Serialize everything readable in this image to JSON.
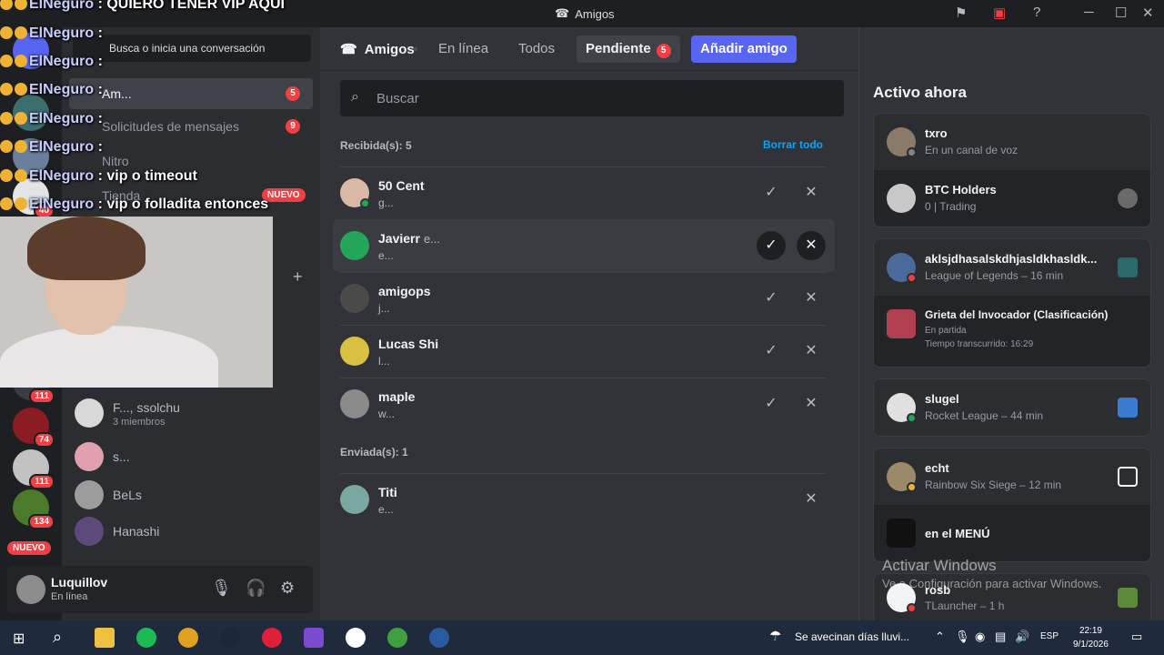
{
  "window": {
    "title": "Amigos",
    "min": "─",
    "max": "☐",
    "close": "✕"
  },
  "sidebar": {
    "search_label": "Busca o inicia una conversación",
    "items": [
      {
        "label": "Am...",
        "count": "5"
      },
      {
        "label": "Solicitudes de mensajes",
        "count": "9"
      },
      {
        "label": "Nitro"
      },
      {
        "label": "Tienda",
        "badge": "NUEVO"
      }
    ],
    "guild_badges": [
      "111",
      "74",
      "111",
      "134"
    ],
    "guild_top_badge": "40",
    "nuevo_badge": "NUEVO",
    "dms": [
      {
        "name": "F..., ssolchu",
        "sub": "3 miembros"
      },
      {
        "name": "s...",
        "sub": ""
      },
      {
        "name": "BeLs",
        "sub": ""
      },
      {
        "name": "Hanashi",
        "sub": ""
      }
    ]
  },
  "user": {
    "name": "Luquillov",
    "status": "En línea"
  },
  "header": {
    "friends": "Amigos",
    "tabs": [
      "En línea",
      "Todos"
    ],
    "pending": "Pendiente",
    "pending_count": "5",
    "add_friend": "Añadir amigo"
  },
  "search": {
    "placeholder": "Buscar"
  },
  "received": {
    "title": "Recibida(s): 5",
    "clear_all": "Borrar todo",
    "items": [
      {
        "name": "50 Cent",
        "tag": "",
        "sub": "g..."
      },
      {
        "name": "Javierr",
        "tag": "e...",
        "sub": "e..."
      },
      {
        "name": "amigops",
        "tag": "",
        "sub": "j..."
      },
      {
        "name": "Lucas Shi",
        "tag": "",
        "sub": "l..."
      },
      {
        "name": "maple",
        "tag": "",
        "sub": "w..."
      }
    ]
  },
  "sent": {
    "title": "Enviada(s): 1",
    "items": [
      {
        "name": "Titi",
        "sub": "e..."
      }
    ]
  },
  "active_now": {
    "title": "Activo ahora",
    "cards": [
      [
        {
          "name": "txro",
          "sub": "En un canal de voz"
        },
        {
          "name": "BTC Holders",
          "sub": "0 | Trading"
        }
      ],
      [
        {
          "name": "aklsjdhasalskdhjasldkhasldk...",
          "sub": "League of Legends – 16 min"
        },
        {
          "name": "Grieta del Invocador (Clasificación)",
          "sub": "En partida",
          "sub2": "Tiempo transcurrido: 16:29"
        }
      ],
      [
        {
          "name": "slugel",
          "sub": "Rocket League – 44 min"
        }
      ],
      [
        {
          "name": "echt",
          "sub": "Rainbow Six Siege – 12 min"
        },
        {
          "name": "en el MENÚ",
          "sub": ""
        }
      ],
      [
        {
          "name": "rosb",
          "sub": "TLauncher – 1 h"
        }
      ]
    ]
  },
  "watermark": {
    "title": "Activar Windows",
    "sub": "Ve a Configuración para activar Windows."
  },
  "chat": [
    {
      "user": "ElNeguro",
      "msg": ": QUIERO TENER VIP AQUI"
    },
    {
      "user": "ElNeguro",
      "msg": ":"
    },
    {
      "user": "ElNeguro",
      "msg": ":"
    },
    {
      "user": "ElNeguro",
      "msg": ":"
    },
    {
      "user": "ElNeguro",
      "msg": ":"
    },
    {
      "user": "ElNeguro",
      "msg": ":"
    },
    {
      "user": "ElNeguro",
      "msg": ": vip o timeout"
    },
    {
      "user": "ElNeguro",
      "msg": ": vip o folladita entonces"
    }
  ],
  "taskbar": {
    "weather": "Se avecinan días lluvi...",
    "lang": "ESP",
    "time": "22:19",
    "date": "9/1/2026"
  }
}
